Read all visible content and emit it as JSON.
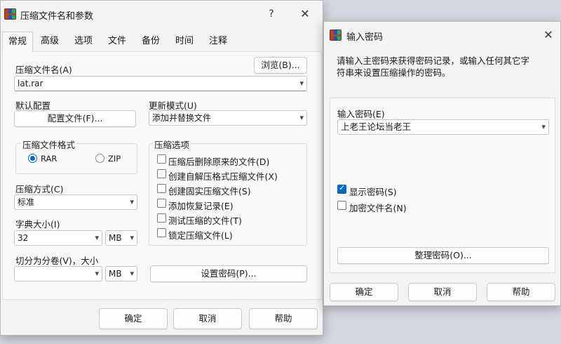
{
  "main": {
    "title": "压缩文件名和参数",
    "help_glyph": "?",
    "close_glyph": "✕",
    "tabs": [
      {
        "label": "常规",
        "active": true
      },
      {
        "label": "高级"
      },
      {
        "label": "选项"
      },
      {
        "label": "文件"
      },
      {
        "label": "备份"
      },
      {
        "label": "时间"
      },
      {
        "label": "注释"
      }
    ],
    "archive_name_label": "压缩文件名(A)",
    "browse_label": "浏览(B)...",
    "archive_name_value": "lat.rar",
    "default_profile_label": "默认配置",
    "profile_button_label": "配置文件(F)...",
    "update_mode_label": "更新模式(U)",
    "update_mode_value": "添加并替换文件",
    "format_group_label": "压缩文件格式",
    "format_rar": "RAR",
    "format_zip": "ZIP",
    "method_label": "压缩方式(C)",
    "method_value": "标准",
    "dict_label": "字典大小(I)",
    "dict_value": "32",
    "dict_unit": "MB",
    "split_label": "切分为分卷(V)，大小",
    "split_value": "",
    "split_unit": "MB",
    "options_group_label": "压缩选项",
    "options": [
      {
        "label": "压缩后删除原来的文件(D)",
        "checked": false
      },
      {
        "label": "创建自解压格式压缩文件(X)",
        "checked": false
      },
      {
        "label": "创建固实压缩文件(S)",
        "checked": false
      },
      {
        "label": "添加恢复记录(E)",
        "checked": false
      },
      {
        "label": "测试压缩的文件(T)",
        "checked": false
      },
      {
        "label": "锁定压缩文件(L)",
        "checked": false
      }
    ],
    "set_password_label": "设置密码(P)...",
    "ok_label": "确定",
    "cancel_label": "取消",
    "help_label": "帮助"
  },
  "password": {
    "title": "输入密码",
    "close_glyph": "✕",
    "instruction_line1": "请输入主密码来获得密码记录，或输入任何其它字",
    "instruction_line2": "符串来设置压缩操作的密码。",
    "enter_label": "输入密码(E)",
    "password_value": "上老王论坛当老王",
    "show_password_label": "显示密码(S)",
    "show_password_checked": true,
    "encrypt_names_label": "加密文件名(N)",
    "encrypt_names_checked": false,
    "organize_label": "整理密码(O)...",
    "ok_label": "确定",
    "cancel_label": "取消",
    "help_label": "帮助"
  },
  "icons": {
    "app": "winrar-books-icon",
    "chevron": "▾"
  },
  "colors": {
    "accent": "#0067c0",
    "dialog_bg": "#f3f3f3",
    "panel_bg": "#f9f9f9"
  }
}
